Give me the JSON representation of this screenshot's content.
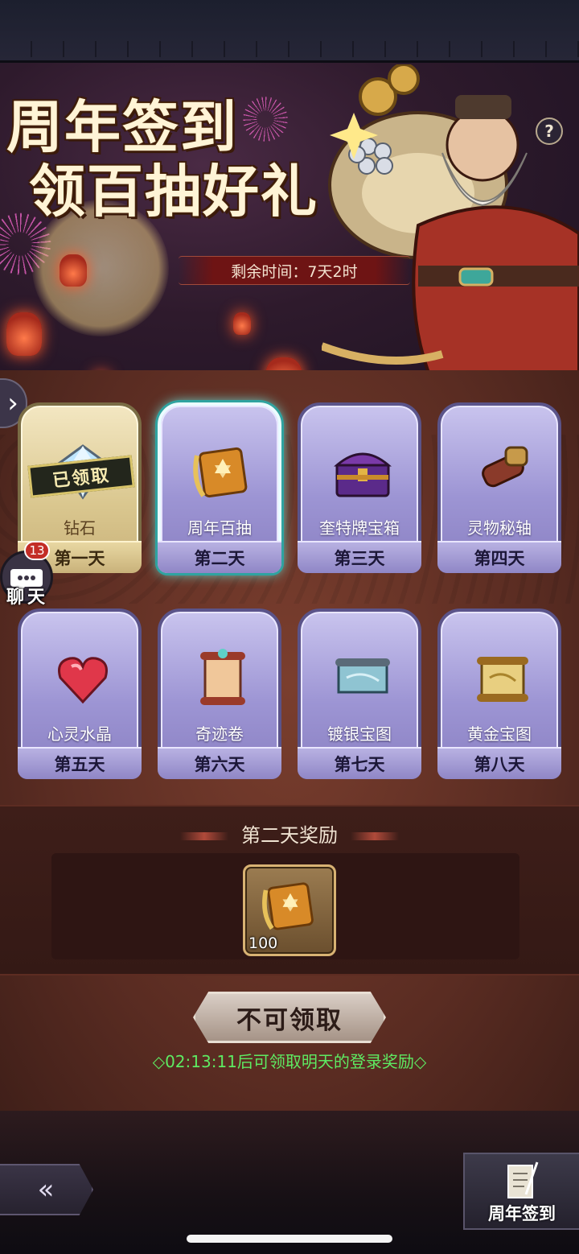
{
  "banner": {
    "title_line1": "周年签到",
    "title_line2": "领百抽好礼",
    "timer": "剩余时间：7天2时",
    "help": "?"
  },
  "days": [
    {
      "item": "钻石",
      "day": "第一天",
      "state": "claimed",
      "stamp": "已领取"
    },
    {
      "item": "周年百抽",
      "day": "第二天",
      "state": "selected"
    },
    {
      "item": "奎特牌宝箱",
      "day": "第三天",
      "state": "locked"
    },
    {
      "item": "灵物秘轴",
      "day": "第四天",
      "state": "locked"
    },
    {
      "item": "心灵水晶",
      "day": "第五天",
      "state": "locked"
    },
    {
      "item": "奇迹卷",
      "day": "第六天",
      "state": "locked"
    },
    {
      "item": "镀银宝图",
      "day": "第七天",
      "state": "locked"
    },
    {
      "item": "黄金宝图",
      "day": "第八天",
      "state": "locked"
    }
  ],
  "chat": {
    "badge": "13",
    "label": "聊天"
  },
  "reward": {
    "title": "第二天奖励",
    "quantity": "100"
  },
  "claim_button": "不可领取",
  "hint": "◇02:13:11后可领取明天的登录奖励◇",
  "side_tab": {
    "label": "周年签到"
  },
  "colors": {
    "hint_green": "#5eea62",
    "selected_glow": "#6ef6ee",
    "card_purple": "#9d95d4",
    "card_gold": "#dac78f"
  }
}
